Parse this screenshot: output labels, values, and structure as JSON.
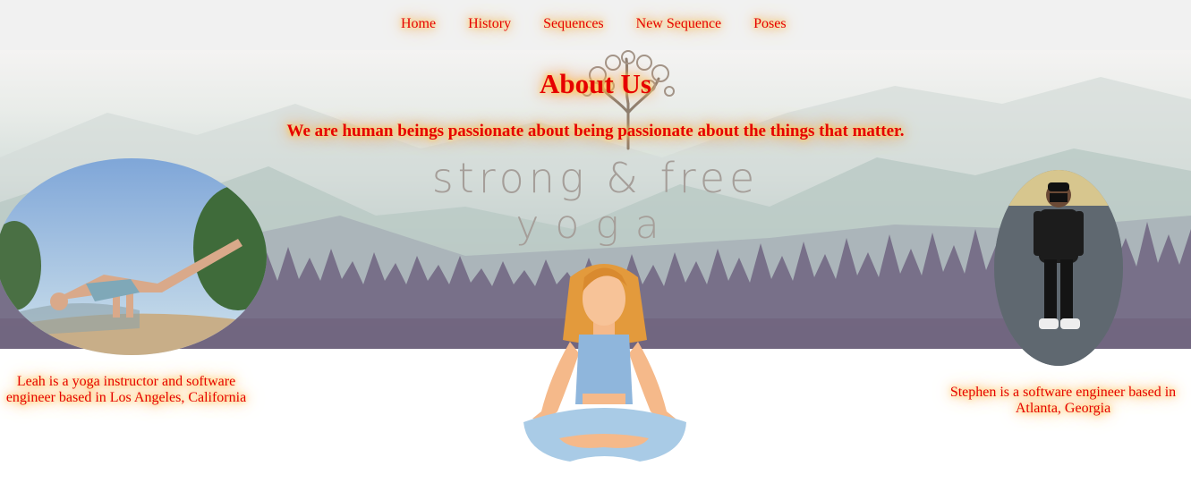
{
  "nav": {
    "items": [
      "Home",
      "History",
      "Sequences",
      "New Sequence",
      "Poses"
    ]
  },
  "page": {
    "title": "About Us",
    "tagline": "We are human beings passionate about being passionate about the things that matter."
  },
  "logo": {
    "line1": "strong & free",
    "line2": "yoga"
  },
  "team": {
    "leah": {
      "caption": "Leah is a yoga instructor and software engineer based in Los Angeles, California"
    },
    "stephen": {
      "caption": "Stephen is a software engineer based in Atlanta, Georgia"
    }
  },
  "colors": {
    "text": "#e60000",
    "glow": "#ffb347",
    "navbar": "#f1f1f1"
  }
}
